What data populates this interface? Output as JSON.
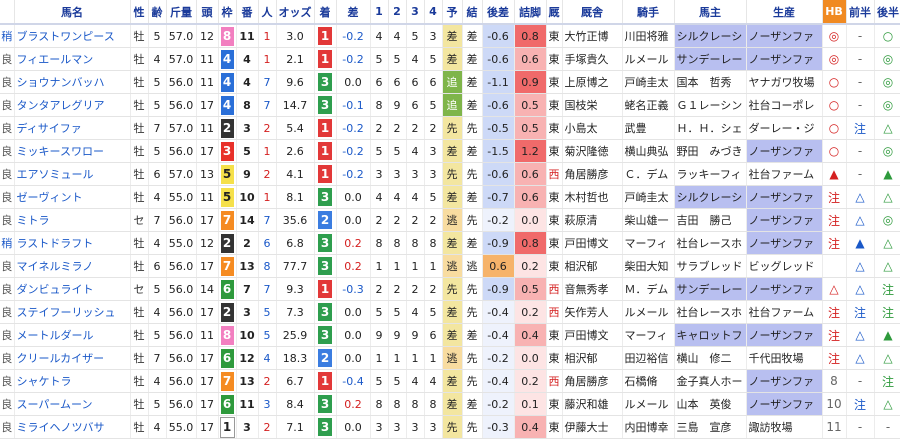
{
  "headers": [
    "馬名",
    "性",
    "齢",
    "斤量",
    "頭",
    "枠",
    "番",
    "人",
    "オッズ",
    "着",
    "差",
    "1",
    "2",
    "3",
    "4",
    "予",
    "結",
    "後差",
    "詰脚",
    "厩",
    "厩舎",
    "騎手",
    "馬主",
    "生産",
    "HB",
    "前半",
    "後半"
  ],
  "rows": [
    {
      "baba": "稍",
      "name": "ブラストワンピース",
      "sex": "牡",
      "age": "5",
      "kin": "57.0",
      "heads": "12",
      "waku": "8",
      "ban": "11",
      "nin": "1",
      "odds": "3.0",
      "chaku": "1",
      "sa": "-0.2",
      "c1": "4",
      "c2": "4",
      "c3": "5",
      "c4": "3",
      "yoso": "差",
      "kek": "差",
      "gosa": "-0.6",
      "tsume": "0.8",
      "stable": "東",
      "trainer": "大竹正博",
      "jockey": "川田将雅",
      "owner": "シルクレーシ",
      "breeder": "ノーザンファ",
      "hb": "◎",
      "zen": "-",
      "kou": "○"
    },
    {
      "baba": "良",
      "name": "フィエールマン",
      "sex": "牡",
      "age": "4",
      "kin": "57.0",
      "heads": "11",
      "waku": "4",
      "ban": "4",
      "nin": "1",
      "odds": "2.1",
      "chaku": "1",
      "sa": "-0.2",
      "c1": "5",
      "c2": "5",
      "c3": "4",
      "c4": "5",
      "yoso": "差",
      "kek": "差",
      "gosa": "-0.6",
      "tsume": "0.6",
      "stable": "東",
      "trainer": "手塚貴久",
      "jockey": "ルメール",
      "owner": "サンデーレー",
      "breeder": "ノーザンファ",
      "hb": "◎",
      "zen": "-",
      "kou": "◎"
    },
    {
      "baba": "良",
      "name": "ショウナンバッハ",
      "sex": "牡",
      "age": "5",
      "kin": "56.0",
      "heads": "11",
      "waku": "4",
      "ban": "4",
      "nin": "7",
      "odds": "9.6",
      "chaku": "3",
      "sa": "0.0",
      "c1": "6",
      "c2": "6",
      "c3": "6",
      "c4": "6",
      "yoso": "追",
      "kek": "差",
      "gosa": "-1.1",
      "tsume": "0.9",
      "stable": "東",
      "trainer": "上原博之",
      "jockey": "戸崎圭太",
      "owner": "国本　哲秀",
      "breeder": "ヤナガワ牧場",
      "hb": "○",
      "zen": "-",
      "kou": "◎"
    },
    {
      "baba": "良",
      "name": "タンタアレグリア",
      "sex": "牡",
      "age": "5",
      "kin": "56.0",
      "heads": "17",
      "waku": "4",
      "ban": "8",
      "nin": "7",
      "odds": "14.7",
      "chaku": "3",
      "sa": "-0.1",
      "c1": "8",
      "c2": "9",
      "c3": "6",
      "c4": "5",
      "yoso": "追",
      "kek": "差",
      "gosa": "-0.6",
      "tsume": "0.5",
      "stable": "東",
      "trainer": "国枝栄",
      "jockey": "蛯名正義",
      "owner": "Ｇ１レーシン",
      "breeder": "社台コーポレ",
      "hb": "○",
      "zen": "-",
      "kou": "◎"
    },
    {
      "baba": "良",
      "name": "ディサイファ",
      "sex": "牡",
      "age": "7",
      "kin": "57.0",
      "heads": "11",
      "waku": "2",
      "ban": "3",
      "nin": "2",
      "odds": "5.4",
      "chaku": "1",
      "sa": "-0.2",
      "c1": "2",
      "c2": "2",
      "c3": "2",
      "c4": "2",
      "yoso": "先",
      "kek": "先",
      "gosa": "-0.5",
      "tsume": "0.5",
      "stable": "東",
      "trainer": "小島太",
      "jockey": "武豊",
      "owner": "Ｈ．Ｈ．シェ",
      "breeder": "ダーレー・ジ",
      "hb": "○",
      "zen": "注",
      "kou": "△"
    },
    {
      "baba": "良",
      "name": "ミッキースワロー",
      "sex": "牡",
      "age": "5",
      "kin": "56.0",
      "heads": "17",
      "waku": "3",
      "ban": "5",
      "nin": "1",
      "odds": "2.6",
      "chaku": "1",
      "sa": "-0.2",
      "c1": "5",
      "c2": "5",
      "c3": "4",
      "c4": "3",
      "yoso": "差",
      "kek": "差",
      "gosa": "-1.5",
      "tsume": "1.2",
      "stable": "東",
      "trainer": "菊沢隆徳",
      "jockey": "横山典弘",
      "owner": "野田　みづき",
      "breeder": "ノーザンファ",
      "hb": "○",
      "zen": "-",
      "kou": "◎"
    },
    {
      "baba": "良",
      "name": "エアソミュール",
      "sex": "牡",
      "age": "6",
      "kin": "57.0",
      "heads": "13",
      "waku": "5",
      "ban": "9",
      "nin": "2",
      "odds": "4.1",
      "chaku": "1",
      "sa": "-0.2",
      "c1": "3",
      "c2": "3",
      "c3": "3",
      "c4": "3",
      "yoso": "先",
      "kek": "先",
      "gosa": "-0.6",
      "tsume": "0.6",
      "stable": "西",
      "trainer": "角居勝彦",
      "jockey": "Ｃ．デム",
      "owner": "ラッキーフィ",
      "breeder": "社台ファーム",
      "hb": "▲",
      "zen": "-",
      "kou": "▲"
    },
    {
      "baba": "良",
      "name": "ゼーヴィント",
      "sex": "牡",
      "age": "4",
      "kin": "55.0",
      "heads": "11",
      "waku": "5",
      "ban": "10",
      "nin": "1",
      "odds": "8.1",
      "chaku": "3",
      "sa": "0.0",
      "c1": "4",
      "c2": "4",
      "c3": "4",
      "c4": "5",
      "yoso": "差",
      "kek": "差",
      "gosa": "-0.7",
      "tsume": "0.6",
      "stable": "東",
      "trainer": "木村哲也",
      "jockey": "戸崎圭太",
      "owner": "シルクレーシ",
      "breeder": "ノーザンファ",
      "hb": "注",
      "zen": "△",
      "kou": "△"
    },
    {
      "baba": "良",
      "name": "ミトラ",
      "sex": "セ",
      "age": "7",
      "kin": "56.0",
      "heads": "17",
      "waku": "7",
      "ban": "14",
      "nin": "7",
      "odds": "35.6",
      "chaku": "2",
      "sa": "0.0",
      "c1": "2",
      "c2": "2",
      "c3": "2",
      "c4": "2",
      "yoso": "逃",
      "kek": "先",
      "gosa": "-0.2",
      "tsume": "0.0",
      "stable": "東",
      "trainer": "萩原清",
      "jockey": "柴山雄一",
      "owner": "吉田　勝己",
      "breeder": "ノーザンファ",
      "hb": "注",
      "zen": "△",
      "kou": "◎"
    },
    {
      "baba": "稍",
      "name": "ラストドラフト",
      "sex": "牡",
      "age": "4",
      "kin": "55.0",
      "heads": "12",
      "waku": "2",
      "ban": "2",
      "nin": "6",
      "odds": "6.8",
      "chaku": "3",
      "sa": "0.2",
      "c1": "8",
      "c2": "8",
      "c3": "8",
      "c4": "8",
      "yoso": "差",
      "kek": "差",
      "gosa": "-0.9",
      "tsume": "0.8",
      "stable": "東",
      "trainer": "戸田博文",
      "jockey": "マーフィ",
      "owner": "社台レースホ",
      "breeder": "ノーザンファ",
      "hb": "注",
      "zen": "▲",
      "kou": "△"
    },
    {
      "baba": "良",
      "name": "マイネルミラノ",
      "sex": "牡",
      "age": "6",
      "kin": "56.0",
      "heads": "17",
      "waku": "7",
      "ban": "13",
      "nin": "8",
      "odds": "77.7",
      "chaku": "3",
      "sa": "0.2",
      "c1": "1",
      "c2": "1",
      "c3": "1",
      "c4": "1",
      "yoso": "逃",
      "kek": "逃",
      "gosa": "0.6",
      "tsume": "0.2",
      "stable": "東",
      "trainer": "相沢郁",
      "jockey": "柴田大知",
      "owner": "サラブレッド",
      "breeder": "ビッグレッド",
      "hb": "",
      "zen": "△",
      "kou": "△"
    },
    {
      "baba": "良",
      "name": "ダンビュライト",
      "sex": "セ",
      "age": "5",
      "kin": "56.0",
      "heads": "14",
      "waku": "6",
      "ban": "7",
      "nin": "7",
      "odds": "9.3",
      "chaku": "1",
      "sa": "-0.3",
      "c1": "2",
      "c2": "2",
      "c3": "2",
      "c4": "2",
      "yoso": "先",
      "kek": "先",
      "gosa": "-0.9",
      "tsume": "0.5",
      "stable": "西",
      "trainer": "音無秀孝",
      "jockey": "Ｍ．デム",
      "owner": "サンデーレー",
      "breeder": "ノーザンファ",
      "hb": "△",
      "zen": "△",
      "kou": "注"
    },
    {
      "baba": "良",
      "name": "ステイフーリッシュ",
      "sex": "牡",
      "age": "4",
      "kin": "56.0",
      "heads": "17",
      "waku": "2",
      "ban": "3",
      "nin": "5",
      "odds": "7.3",
      "chaku": "3",
      "sa": "0.0",
      "c1": "5",
      "c2": "5",
      "c3": "4",
      "c4": "5",
      "yoso": "差",
      "kek": "先",
      "gosa": "-0.4",
      "tsume": "0.2",
      "stable": "西",
      "trainer": "矢作芳人",
      "jockey": "ルメール",
      "owner": "社台レースホ",
      "breeder": "社台ファーム",
      "hb": "注",
      "zen": "注",
      "kou": "注"
    },
    {
      "baba": "良",
      "name": "メートルダール",
      "sex": "牡",
      "age": "5",
      "kin": "56.0",
      "heads": "11",
      "waku": "8",
      "ban": "10",
      "nin": "5",
      "odds": "25.9",
      "chaku": "3",
      "sa": "0.0",
      "c1": "9",
      "c2": "9",
      "c3": "9",
      "c4": "6",
      "yoso": "差",
      "kek": "差",
      "gosa": "-0.4",
      "tsume": "0.4",
      "stable": "東",
      "trainer": "戸田博文",
      "jockey": "マーフィ",
      "owner": "キャロットフ",
      "breeder": "ノーザンファ",
      "hb": "注",
      "zen": "△",
      "kou": "▲"
    },
    {
      "baba": "良",
      "name": "クリールカイザー",
      "sex": "牡",
      "age": "7",
      "kin": "56.0",
      "heads": "17",
      "waku": "6",
      "ban": "12",
      "nin": "4",
      "odds": "18.3",
      "chaku": "2",
      "sa": "0.0",
      "c1": "1",
      "c2": "1",
      "c3": "1",
      "c4": "1",
      "yoso": "逃",
      "kek": "先",
      "gosa": "-0.2",
      "tsume": "0.0",
      "stable": "東",
      "trainer": "相沢郁",
      "jockey": "田辺裕信",
      "owner": "横山　修二",
      "breeder": "千代田牧場",
      "hb": "注",
      "zen": "△",
      "kou": "△"
    },
    {
      "baba": "良",
      "name": "シャケトラ",
      "sex": "牡",
      "age": "4",
      "kin": "56.0",
      "heads": "17",
      "waku": "7",
      "ban": "13",
      "nin": "2",
      "odds": "6.7",
      "chaku": "1",
      "sa": "-0.4",
      "c1": "5",
      "c2": "5",
      "c3": "4",
      "c4": "4",
      "yoso": "差",
      "kek": "先",
      "gosa": "-0.4",
      "tsume": "0.2",
      "stable": "西",
      "trainer": "角居勝彦",
      "jockey": "石橋脩",
      "owner": "金子真人ホー",
      "breeder": "ノーザンファ",
      "hb": "8",
      "zen": "-",
      "kou": "注"
    },
    {
      "baba": "良",
      "name": "スーパームーン",
      "sex": "牡",
      "age": "5",
      "kin": "56.0",
      "heads": "17",
      "waku": "6",
      "ban": "11",
      "nin": "3",
      "odds": "8.4",
      "chaku": "3",
      "sa": "0.2",
      "c1": "8",
      "c2": "8",
      "c3": "8",
      "c4": "8",
      "yoso": "差",
      "kek": "差",
      "gosa": "-0.2",
      "tsume": "0.1",
      "stable": "東",
      "trainer": "藤沢和雄",
      "jockey": "ルメール",
      "owner": "山本　英俊",
      "breeder": "ノーザンファ",
      "hb": "10",
      "zen": "注",
      "kou": "△"
    },
    {
      "baba": "良",
      "name": "ミライヘノツバサ",
      "sex": "牡",
      "age": "4",
      "kin": "55.0",
      "heads": "17",
      "waku": "1",
      "ban": "3",
      "nin": "2",
      "odds": "7.1",
      "chaku": "3",
      "sa": "0.0",
      "c1": "3",
      "c2": "3",
      "c3": "3",
      "c4": "3",
      "yoso": "先",
      "kek": "先",
      "gosa": "-0.3",
      "tsume": "0.4",
      "stable": "東",
      "trainer": "伊藤大士",
      "jockey": "内田博幸",
      "owner": "三島　宣彦",
      "breeder": "諏訪牧場",
      "hb": "11",
      "zen": "-",
      "kou": "-"
    }
  ],
  "colors": {
    "waku": {
      "1": "#ffffff",
      "2": "#333333",
      "3": "#e8312a",
      "4": "#2a6fd8",
      "5": "#f5e04a",
      "6": "#2e9a3c",
      "7": "#f58b22",
      "8": "#f27fc0"
    },
    "chaku": {
      "1": "#e23838",
      "2": "#3b7de0",
      "3": "#2e9e4e"
    },
    "tsume_hot": "#f06a6a",
    "tsume_warm": "#f8b2b2",
    "gosa_hot": "#f6b36a"
  }
}
